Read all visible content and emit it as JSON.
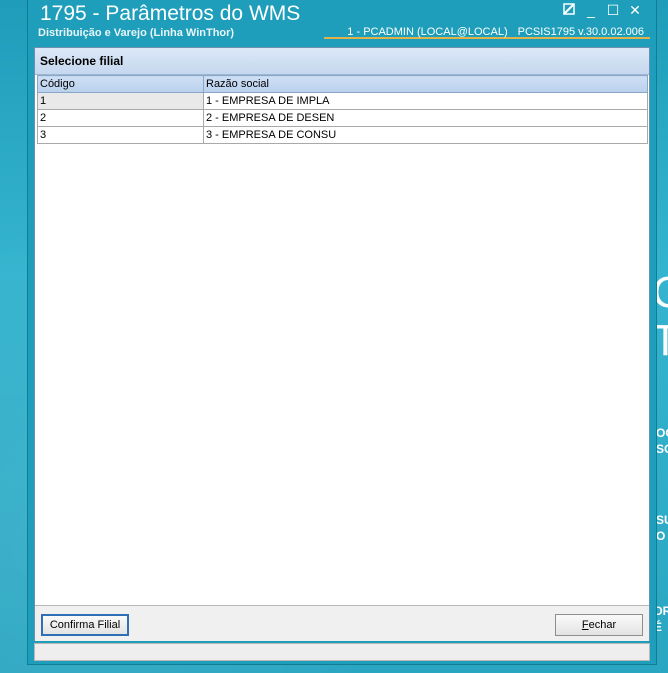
{
  "window": {
    "title": "1795 - Parâmetros do WMS",
    "subtitle": "Distribuição e Varejo (Linha WinThor)",
    "session_user": "1 - PCADMIN (LOCAL@LOCAL)",
    "session_program": "PCSIS1795  v.30.0.02.006",
    "controls": {
      "restore_icon": "restore-icon",
      "minimize": "_",
      "maximize": "☐",
      "close": "✕"
    }
  },
  "panel": {
    "title": "Selecione filial",
    "columns": [
      "Código",
      "Razão social"
    ],
    "rows": [
      {
        "code": "1",
        "name": "1 - EMPRESA DE IMPLA"
      },
      {
        "code": "2",
        "name": "2 - EMPRESA DE DESEN"
      },
      {
        "code": "3",
        "name": "3 - EMPRESA DE CONSU"
      }
    ]
  },
  "buttons": {
    "confirm": "Confirma Filial",
    "close_prefix": "F",
    "close_rest": "echar"
  },
  "background_text": {
    "line1": "OGI",
    "line2": "SO",
    "line3": "SU",
    "line4": "O",
    "line5": "DR",
    "line6": "É I"
  },
  "colors": {
    "accent": "#1e9eba",
    "header": "#c5d8ef",
    "selection_border": "#2e6fb5",
    "session_underline": "#e0b24a"
  }
}
